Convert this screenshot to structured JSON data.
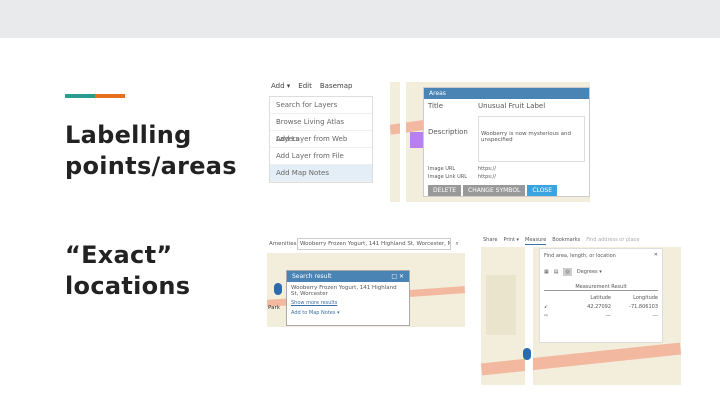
{
  "slide": {
    "heading1": "Labelling points/areas",
    "heading2": "“Exact” locations",
    "accent_colors": [
      "#2a9d8f",
      "#e76f1e"
    ]
  },
  "shot1": {
    "toolbar": [
      "Add ▾",
      "Edit",
      "Basemap"
    ],
    "menu": [
      "Search for Layers",
      "Browse Living Atlas Layers",
      "Add Layer from Web",
      "Add Layer from File",
      "Add Map Notes"
    ],
    "selected": "Add Map Notes"
  },
  "shot2": {
    "title": "Areas",
    "fields": {
      "title_label": "Title",
      "title_value": "Unusual Fruit Label",
      "description_label": "Description",
      "description_value": "Wooberry is now mysterious and unspecified",
      "image_label": "Image URL",
      "image_value": "https://",
      "link_label": "Image Link URL",
      "link_value": "https://"
    },
    "buttons": [
      "DELETE",
      "CHANGE SYMBOL",
      "CLOSE"
    ]
  },
  "shot3": {
    "search_label": "Amenities",
    "search_value": "Wooberry Frozen Yogurt, 141 Highland St, Worcester, MA",
    "popup_title": "Search result",
    "popup_text": "Wooberry Frozen Yogurt, 141 Highland St, Worcester",
    "more": "Show more results",
    "add": "Add to Map Notes ▾",
    "map_label": "Park"
  },
  "shot4": {
    "toolbar": [
      "Share",
      "Print ▾",
      "Measure",
      "Bookmarks",
      "Find address or place"
    ],
    "prompt": "Find area, length, or location",
    "unit": "Degrees ▾",
    "result_title": "Measurement Result",
    "col1": "Latitude",
    "col2": "Longitude",
    "lat": "42.27092",
    "lon": "-71.806103",
    "empty1": "---",
    "empty2": "---"
  }
}
